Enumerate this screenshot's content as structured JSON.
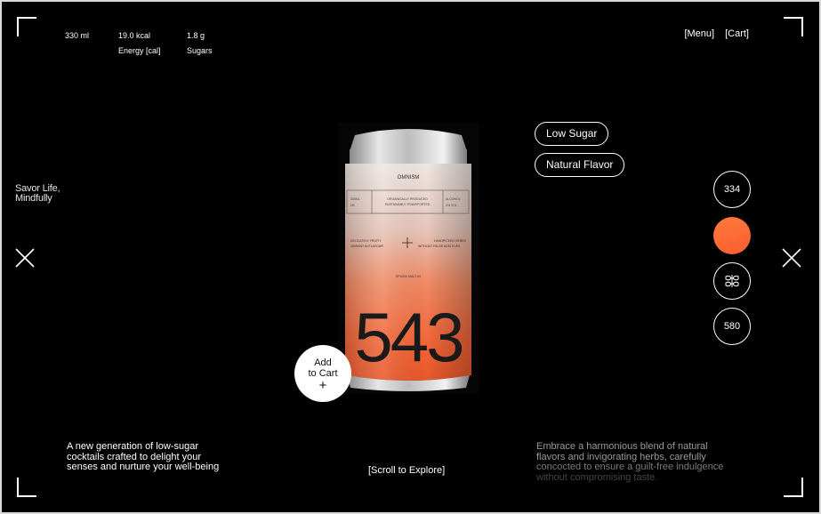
{
  "stats": [
    {
      "value": "330 ml",
      "label": ""
    },
    {
      "value": "19.0 kcal",
      "label": "Energy [cal]"
    },
    {
      "value": "1.8 g",
      "label": "Sugars"
    }
  ],
  "nav": {
    "menu": "[Menu]",
    "cart": "[Cart]"
  },
  "tagline": [
    "Savor Life,",
    "Mindfully"
  ],
  "can": {
    "brand": "OMNISM",
    "box_left": [
      "330ML",
      "UK"
    ],
    "box_center": [
      "ORGANICALLY PRODUCED",
      "SUSTAINABLY TRANSPORTED"
    ],
    "box_right": [
      "ALCOHOL",
      "0% VOL"
    ],
    "note_left": [
      "DELICATELY FRUITY",
      "VIBRANT IN FLAVOUR"
    ],
    "note_right": [
      "HANDPICKED HERBS",
      "WITHOUT FALSE ADDITIVES"
    ],
    "sub": "SPICED MALT 04",
    "number": "543",
    "colors": {
      "top": "#d9a39a",
      "mid": "#f26a3a",
      "bottom": "#e8531f",
      "metal": "#cfcfcf"
    }
  },
  "add_to_cart": {
    "line1": "Add",
    "line2": "to Cart",
    "plus": "+"
  },
  "tags": [
    "Low Sugar",
    "Natural Flavor"
  ],
  "selectors": {
    "first": "334",
    "last": "580",
    "swatch_color": "#fa6632"
  },
  "intro": [
    "A new generation of low-sugar",
    "cocktails crafted to delight your",
    "senses and nurture your well-being"
  ],
  "scroll": "[Scroll to Explore]",
  "description": [
    "Embrace a harmonious blend of natural",
    "flavors and invigorating herbs, carefully",
    "concocted to ensure a guilt-free indulgence",
    "without compromising  taste."
  ]
}
